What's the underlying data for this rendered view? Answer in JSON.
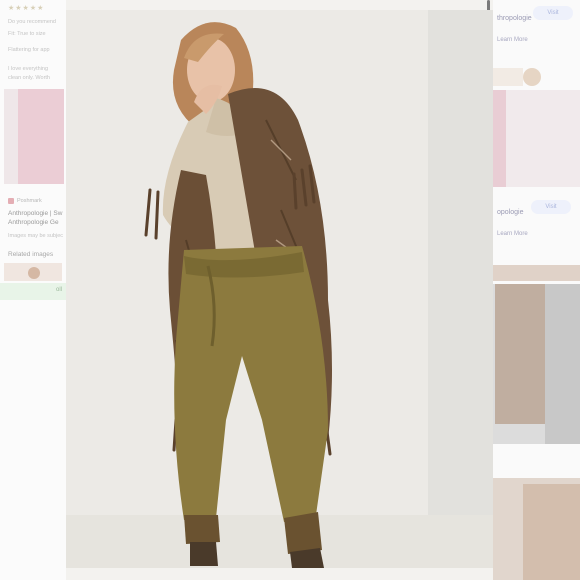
{
  "left_panel": {
    "rating_stars": "★★★★★",
    "review_line_1": "Do you recommend",
    "review_line_2": "Fit: True to size",
    "review_line_3": "Flattering for app",
    "review_line_4": "I love everything",
    "review_line_5": "clean only. Worth",
    "source_name": "Poshmark",
    "source_title_1": "Anthropologie | Sw",
    "source_title_2": "Anthropologie Ge",
    "copyright_note": "Images may be subjec",
    "related_heading": "Related images",
    "green_button": "oll"
  },
  "right_panel": {
    "result_1_title": "thropologie",
    "result_1_visit": "Visit",
    "result_1_learn_more": "Learn More",
    "result_2_title": "opologie",
    "result_2_visit": "Visit",
    "result_2_learn_more": "Learn More"
  },
  "colors": {
    "pants": "#8c7a3e",
    "shawl": "#6b5038",
    "sweater": "#d9ccb6",
    "wall": "#ecebe7"
  }
}
